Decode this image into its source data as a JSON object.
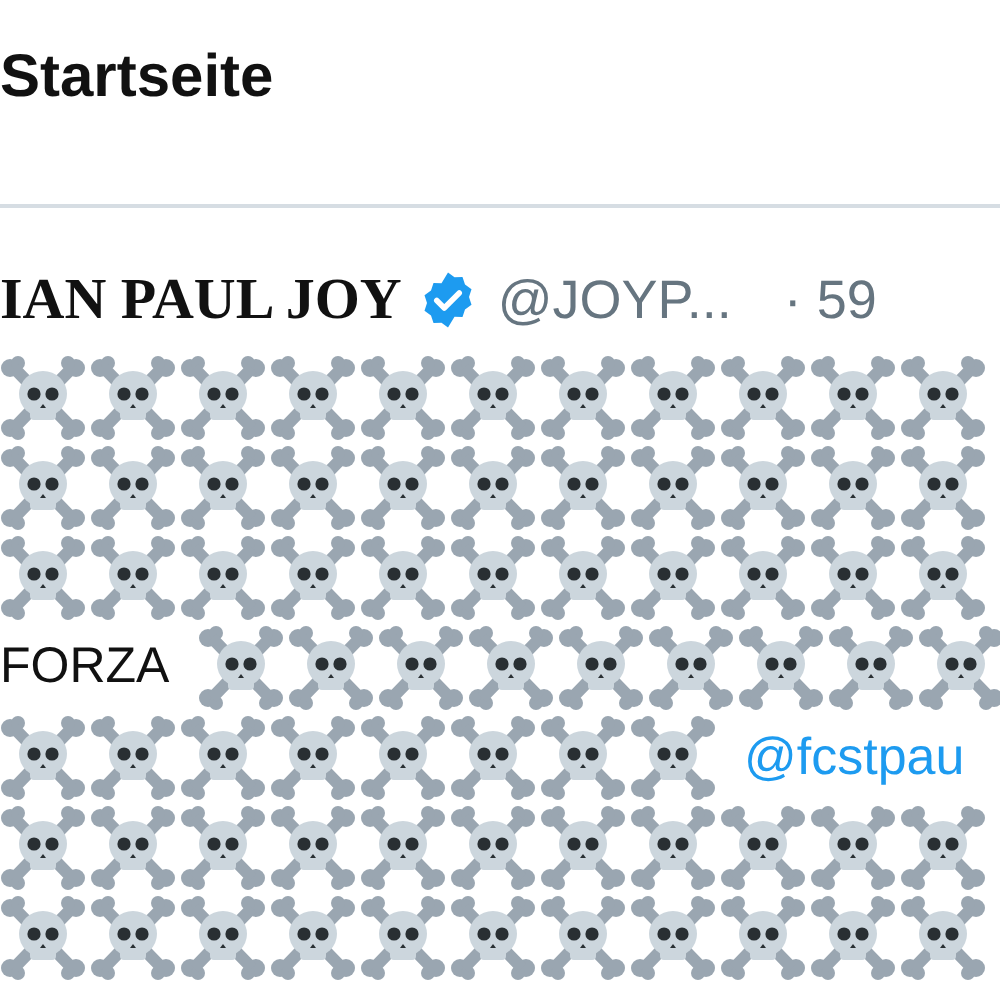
{
  "header": {
    "title": "Startseite"
  },
  "tweet": {
    "author": "IAN PAUL JOY",
    "verified": true,
    "handle": "@JOYP...",
    "time": "· 59",
    "lines": [
      [
        {
          "kind": "skull"
        },
        {
          "kind": "skull"
        },
        {
          "kind": "skull"
        },
        {
          "kind": "skull"
        },
        {
          "kind": "skull"
        },
        {
          "kind": "skull"
        },
        {
          "kind": "skull"
        },
        {
          "kind": "skull"
        },
        {
          "kind": "skull"
        },
        {
          "kind": "skull"
        },
        {
          "kind": "skull"
        }
      ],
      [
        {
          "kind": "skull"
        },
        {
          "kind": "skull"
        },
        {
          "kind": "skull"
        },
        {
          "kind": "skull"
        },
        {
          "kind": "skull"
        },
        {
          "kind": "skull"
        },
        {
          "kind": "skull"
        },
        {
          "kind": "skull"
        },
        {
          "kind": "skull"
        },
        {
          "kind": "skull"
        },
        {
          "kind": "skull"
        }
      ],
      [
        {
          "kind": "skull"
        },
        {
          "kind": "skull"
        },
        {
          "kind": "skull"
        },
        {
          "kind": "skull"
        },
        {
          "kind": "skull"
        },
        {
          "kind": "skull"
        },
        {
          "kind": "skull"
        },
        {
          "kind": "skull"
        },
        {
          "kind": "skull"
        },
        {
          "kind": "skull"
        },
        {
          "kind": "skull"
        }
      ],
      [
        {
          "kind": "text",
          "text": "FORZA"
        },
        {
          "kind": "skull"
        },
        {
          "kind": "skull"
        },
        {
          "kind": "skull"
        },
        {
          "kind": "skull"
        },
        {
          "kind": "skull"
        },
        {
          "kind": "skull"
        },
        {
          "kind": "skull"
        },
        {
          "kind": "skull"
        },
        {
          "kind": "skull"
        }
      ],
      [
        {
          "kind": "skull"
        },
        {
          "kind": "skull"
        },
        {
          "kind": "skull"
        },
        {
          "kind": "skull"
        },
        {
          "kind": "skull"
        },
        {
          "kind": "skull"
        },
        {
          "kind": "skull"
        },
        {
          "kind": "skull"
        },
        {
          "kind": "mention",
          "text": "@fcstpau"
        }
      ],
      [
        {
          "kind": "skull"
        },
        {
          "kind": "skull"
        },
        {
          "kind": "skull"
        },
        {
          "kind": "skull"
        },
        {
          "kind": "skull"
        },
        {
          "kind": "skull"
        },
        {
          "kind": "skull"
        },
        {
          "kind": "skull"
        },
        {
          "kind": "skull"
        },
        {
          "kind": "skull"
        },
        {
          "kind": "skull"
        }
      ],
      [
        {
          "kind": "skull"
        },
        {
          "kind": "skull"
        },
        {
          "kind": "skull"
        },
        {
          "kind": "skull"
        },
        {
          "kind": "skull"
        },
        {
          "kind": "skull"
        },
        {
          "kind": "skull"
        },
        {
          "kind": "skull"
        },
        {
          "kind": "skull"
        },
        {
          "kind": "skull"
        },
        {
          "kind": "skull"
        }
      ]
    ]
  }
}
